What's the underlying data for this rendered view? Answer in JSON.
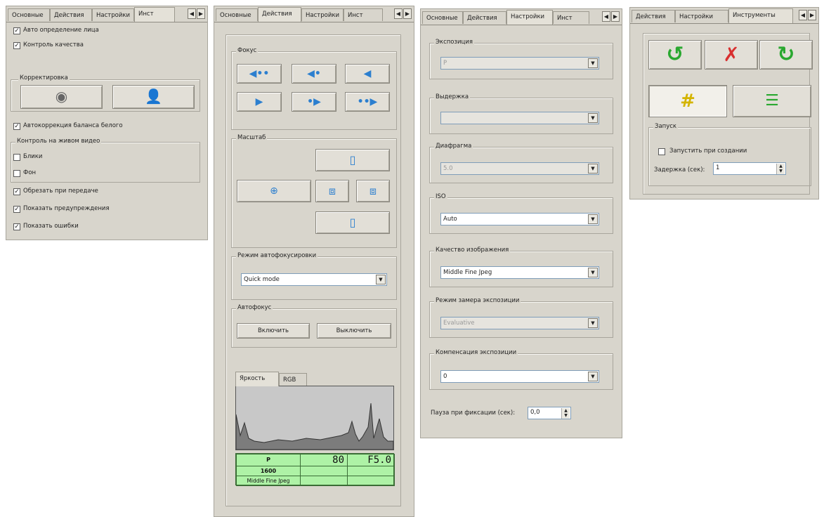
{
  "panel1": {
    "tabs": [
      "Основные",
      "Действия",
      "Настройки",
      "Инст"
    ],
    "checks": {
      "face": {
        "label": "Авто определение лица",
        "checked": true
      },
      "quality": {
        "label": "Контроль качества",
        "checked": true
      }
    },
    "correction_group": "Корректировка",
    "white_balance": {
      "label": "Автокоррекция баланса белого",
      "checked": true
    },
    "live_group": "Контроль на живом видео",
    "glare": {
      "label": "Блики",
      "checked": false
    },
    "background": {
      "label": "Фон",
      "checked": false
    },
    "crop": {
      "label": "Обрезать при передаче",
      "checked": true
    },
    "warnings": {
      "label": "Показать предупреждения",
      "checked": true
    },
    "errors": {
      "label": "Показать ошибки",
      "checked": true
    }
  },
  "panel2": {
    "tabs": [
      "Основные",
      "Действия",
      "Настройки",
      "Инст"
    ],
    "focus_group": "Фокус",
    "scale_group": "Масштаб",
    "af_mode_group": "Режим автофокусировки",
    "af_mode_value": "Quick mode",
    "af_group": "Автофокус",
    "enable_label": "Включить",
    "disable_label": "Выключить",
    "hist_tabs": [
      "Яркость",
      "RGB"
    ],
    "lcd": {
      "mode": "P",
      "shutter": "80",
      "aperture": "F5.0",
      "iso": "1600",
      "quality": "Middle Fine Jpeg"
    }
  },
  "panel3": {
    "tabs": [
      "Основные",
      "Действия",
      "Настройки",
      "Инст"
    ],
    "exposure_group": "Экспозиция",
    "exposure_value": "P",
    "shutter_group": "Выдержка",
    "shutter_value": "",
    "aperture_group": "Диафрагма",
    "aperture_value": "5.0",
    "iso_group": "ISO",
    "iso_value": "Auto",
    "quality_group": "Качество изображения",
    "quality_value": "Middle Fine Jpeg",
    "metering_group": "Режим замера экспозиции",
    "metering_value": "Evaluative",
    "comp_group": "Компенсация экспозиции",
    "comp_value": "0",
    "pause_label": "Пауза при фиксации (сек):",
    "pause_value": "0,0"
  },
  "panel4": {
    "tabs": [
      "Действия",
      "Настройки",
      "Инструменты"
    ],
    "start_group": "Запуск",
    "run_on_create": {
      "label": "Запустить при создании",
      "checked": false
    },
    "delay_label": "Задержка (сек):",
    "delay_value": "1"
  },
  "colors": {
    "panel_bg": "#d8d5cc",
    "accent_blue": "#3d8fd8",
    "green": "#2aa830",
    "lcd_bg": "#aef2a6"
  }
}
